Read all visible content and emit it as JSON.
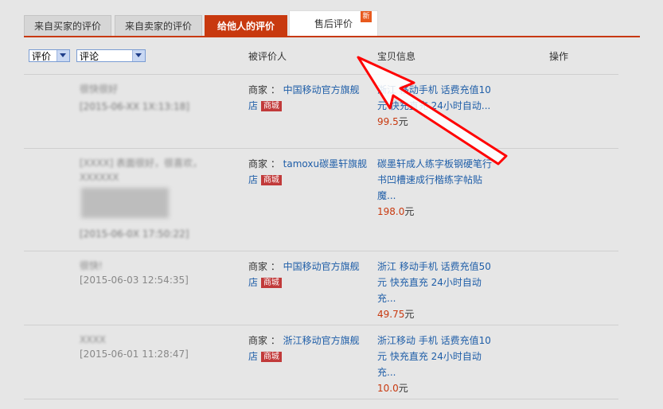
{
  "tabs": [
    {
      "label": "来自买家的评价"
    },
    {
      "label": "来自卖家的评价"
    },
    {
      "label": "给他人的评价"
    },
    {
      "label": "售后评价",
      "badge": "新"
    }
  ],
  "filters": {
    "rating_select": "评价",
    "comment_select": "评论"
  },
  "headers": {
    "target": "被评价人",
    "item": "宝贝信息",
    "ops": "操作"
  },
  "rows": [
    {
      "comment": "很快很好",
      "date": "[2015-06-XX 1X:13:18]",
      "seller_prefix": "商家 ：",
      "seller_name": "中国移动官方旗舰店",
      "mall": "商城",
      "item_title": "浙江 移动手机 话费充值10元 快充直充 24小时自动...",
      "price": "99.5",
      "unit": "元"
    },
    {
      "comment": "[XXXX] 表面很好，很喜欢，",
      "comment2": "XXXXXX",
      "date": "[2015-06-0X 17:50:22]",
      "seller_prefix": "商家 ：",
      "seller_name": "tamoxu碳墨轩旗舰店",
      "mall": "商城",
      "item_title": "碳墨轩成人练字板钢硬笔行书凹槽速成行楷练字帖贴魔...",
      "price": "198.0",
      "unit": "元"
    },
    {
      "comment": "很快!",
      "date": "[2015-06-03 12:54:35]",
      "seller_prefix": "商家 ：",
      "seller_name": "中国移动官方旗舰店",
      "mall": "商城",
      "item_title": "浙江 移动手机 话费充值50元 快充直充 24小时自动充...",
      "price": "49.75",
      "unit": "元"
    },
    {
      "comment": "XXXX",
      "date": "[2015-06-01 11:28:47]",
      "seller_prefix": "商家 ：",
      "seller_name": "浙江移动官方旗舰店",
      "mall": "商城",
      "item_title": "浙江移动 手机 话费充值10元 快充直充 24小时自动充...",
      "price": "10.0",
      "unit": "元"
    }
  ],
  "colors": {
    "accent": "#c8390f",
    "link": "#1f5ea8",
    "annotation_arrow": "#ff0000"
  }
}
